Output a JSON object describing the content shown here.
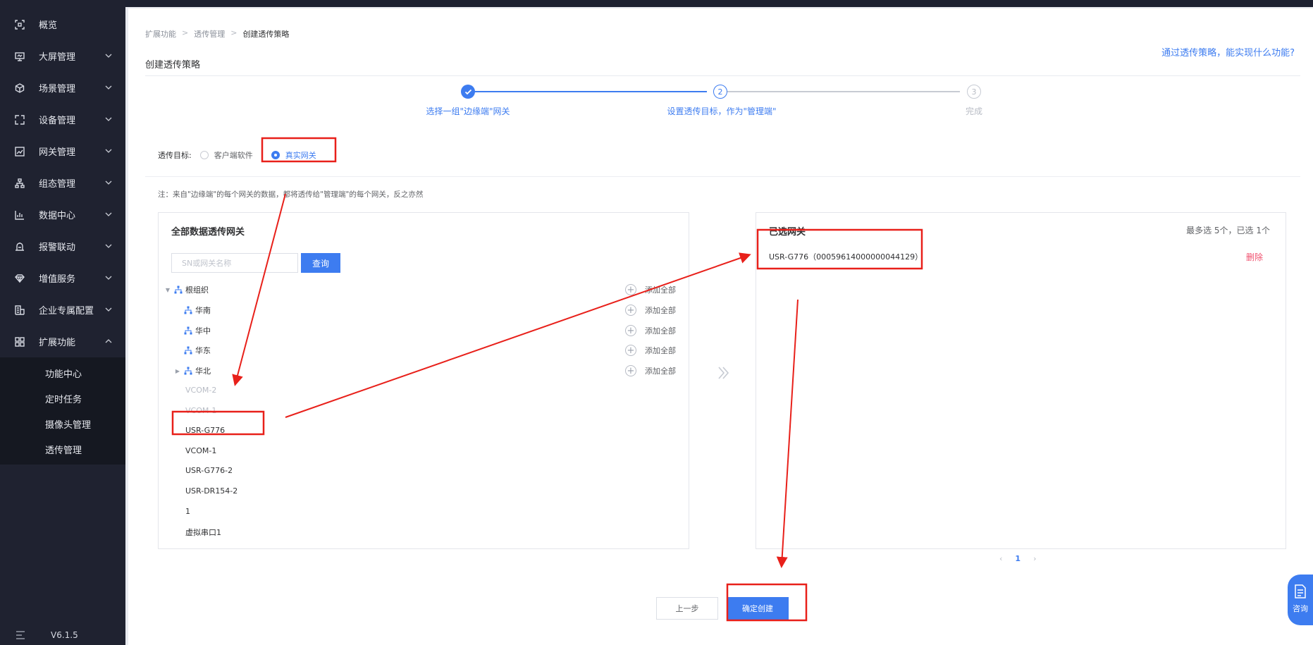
{
  "sidebar": {
    "items": [
      {
        "label": "概览",
        "icon": "overview-icon",
        "expandable": false
      },
      {
        "label": "大屏管理",
        "icon": "screen-icon",
        "expandable": true
      },
      {
        "label": "场景管理",
        "icon": "cube-icon",
        "expandable": true
      },
      {
        "label": "设备管理",
        "icon": "device-icon",
        "expandable": true
      },
      {
        "label": "网关管理",
        "icon": "chart-icon",
        "expandable": true
      },
      {
        "label": "组态管理",
        "icon": "hierarchy-icon",
        "expandable": true
      },
      {
        "label": "数据中心",
        "icon": "bar-chart-icon",
        "expandable": true
      },
      {
        "label": "报警联动",
        "icon": "alarm-icon",
        "expandable": true
      },
      {
        "label": "增值服务",
        "icon": "diamond-icon",
        "expandable": true
      },
      {
        "label": "企业专属配置",
        "icon": "building-icon",
        "expandable": true
      },
      {
        "label": "扩展功能",
        "icon": "grid-icon",
        "expandable": true,
        "expanded": true
      }
    ],
    "submenu": [
      "功能中心",
      "定时任务",
      "摄像头管理",
      "透传管理"
    ],
    "version": "V6.1.5"
  },
  "breadcrumb": {
    "items": [
      "扩展功能",
      "透传管理",
      "创建透传策略"
    ],
    "separator": ">"
  },
  "page_title": "创建透传策略",
  "help_link": "通过透传策略，能实现什么功能?",
  "steps": [
    {
      "number": "1",
      "label": "选择一组\"边缘端\"网关",
      "status": "done"
    },
    {
      "number": "2",
      "label": "设置透传目标，作为\"管理端\"",
      "status": "active"
    },
    {
      "number": "3",
      "label": "完成",
      "status": "todo"
    }
  ],
  "target": {
    "label": "透传目标:",
    "options": [
      {
        "label": "客户端软件",
        "checked": false
      },
      {
        "label": "真实网关",
        "checked": true
      }
    ]
  },
  "note": "注：来自\"边缘端\"的每个网关的数据，都将透传给\"管理端\"的每个网关，反之亦然",
  "left_panel": {
    "title": "全部数据透传网关",
    "search": {
      "placeholder": "SN或网关名称",
      "value": ""
    },
    "search_button": "查询",
    "tree": [
      {
        "label": "根组织",
        "level": 0,
        "caret": "down",
        "add_label": "添加全部"
      },
      {
        "label": "华南",
        "level": 1,
        "caret": "",
        "add_label": "添加全部"
      },
      {
        "label": "华中",
        "level": 1,
        "caret": "",
        "add_label": "添加全部"
      },
      {
        "label": "华东",
        "level": 1,
        "caret": "",
        "add_label": "添加全部"
      },
      {
        "label": "华北",
        "level": 1,
        "caret": "right",
        "add_label": "添加全部"
      }
    ],
    "gateways": [
      {
        "label": "VCOM-2",
        "disabled": true
      },
      {
        "label": "VCOM-1",
        "disabled": true
      },
      {
        "label": "USR-G776",
        "disabled": false
      },
      {
        "label": "VCOM-1",
        "disabled": false
      },
      {
        "label": "USR-G776-2",
        "disabled": false
      },
      {
        "label": "USR-DR154-2",
        "disabled": false
      },
      {
        "label": "1",
        "disabled": false
      },
      {
        "label": "虚拟串口1",
        "disabled": false
      }
    ]
  },
  "right_panel": {
    "title": "已选网关",
    "count_text": "最多选 5个，已选 1个",
    "selected": [
      {
        "label": "USR-G776（00059614000000044129）",
        "delete_label": "删除"
      }
    ]
  },
  "pagination": {
    "prev": "‹",
    "page": "1",
    "next": "›"
  },
  "buttons": {
    "prev": "上一步",
    "confirm": "确定创建"
  },
  "consult": {
    "label": "咨询"
  },
  "colors": {
    "primary": "#3d7cf0",
    "sidebar_bg": "#1f2230",
    "danger": "#f0506e",
    "annotation": "#e8201a"
  }
}
